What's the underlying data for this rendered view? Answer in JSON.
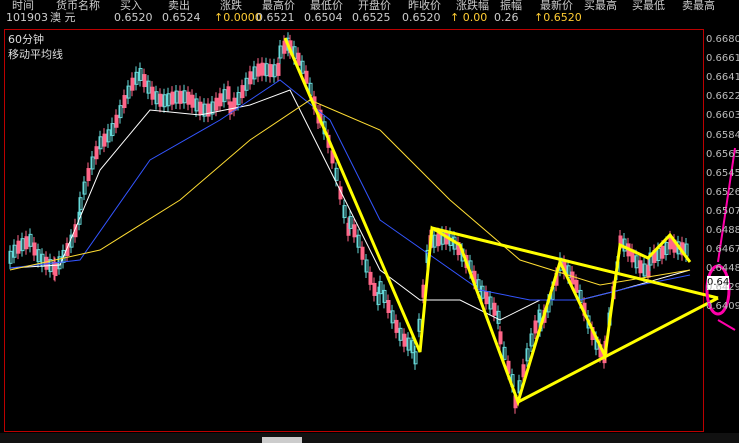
{
  "quote": {
    "headers": [
      "时间",
      "货币名称",
      "买入",
      "卖出",
      "涨跌",
      "最高价",
      "最低价",
      "开盘价",
      "昨收价",
      "涨跌幅",
      "振幅",
      "最新价",
      "买最高",
      "买最低",
      "卖最高"
    ],
    "values": [
      "101903",
      "澳    元",
      "0.6520",
      "0.6524",
      "↑0.0000",
      "0.6521",
      "0.6504",
      "0.6525",
      "0.6520",
      "↑ 0.00",
      "0.26",
      "↑0.6520",
      "",
      "",
      ""
    ]
  },
  "chart": {
    "title": "60分钟",
    "subtitle": "移动平均线",
    "cursor_value": "0.6491"
  },
  "y_axis": {
    "labels": [
      "0.6680",
      "0.6661",
      "0.6641",
      "0.6622",
      "0.6603",
      "0.6584",
      "0.6565",
      "0.6545",
      "0.6526",
      "0.6507",
      "0.6488",
      "0.6467",
      "0.6448",
      "0.6429",
      "0.6409"
    ]
  },
  "colors": {
    "bull": "#66d9d9",
    "bear": "#ff6688",
    "ma1": "#ffffff",
    "ma2": "#ffff00",
    "ma3": "#3355ff",
    "ma4": "#ffff66",
    "annotation": "#ffff00",
    "circle": "#ff00aa"
  }
}
